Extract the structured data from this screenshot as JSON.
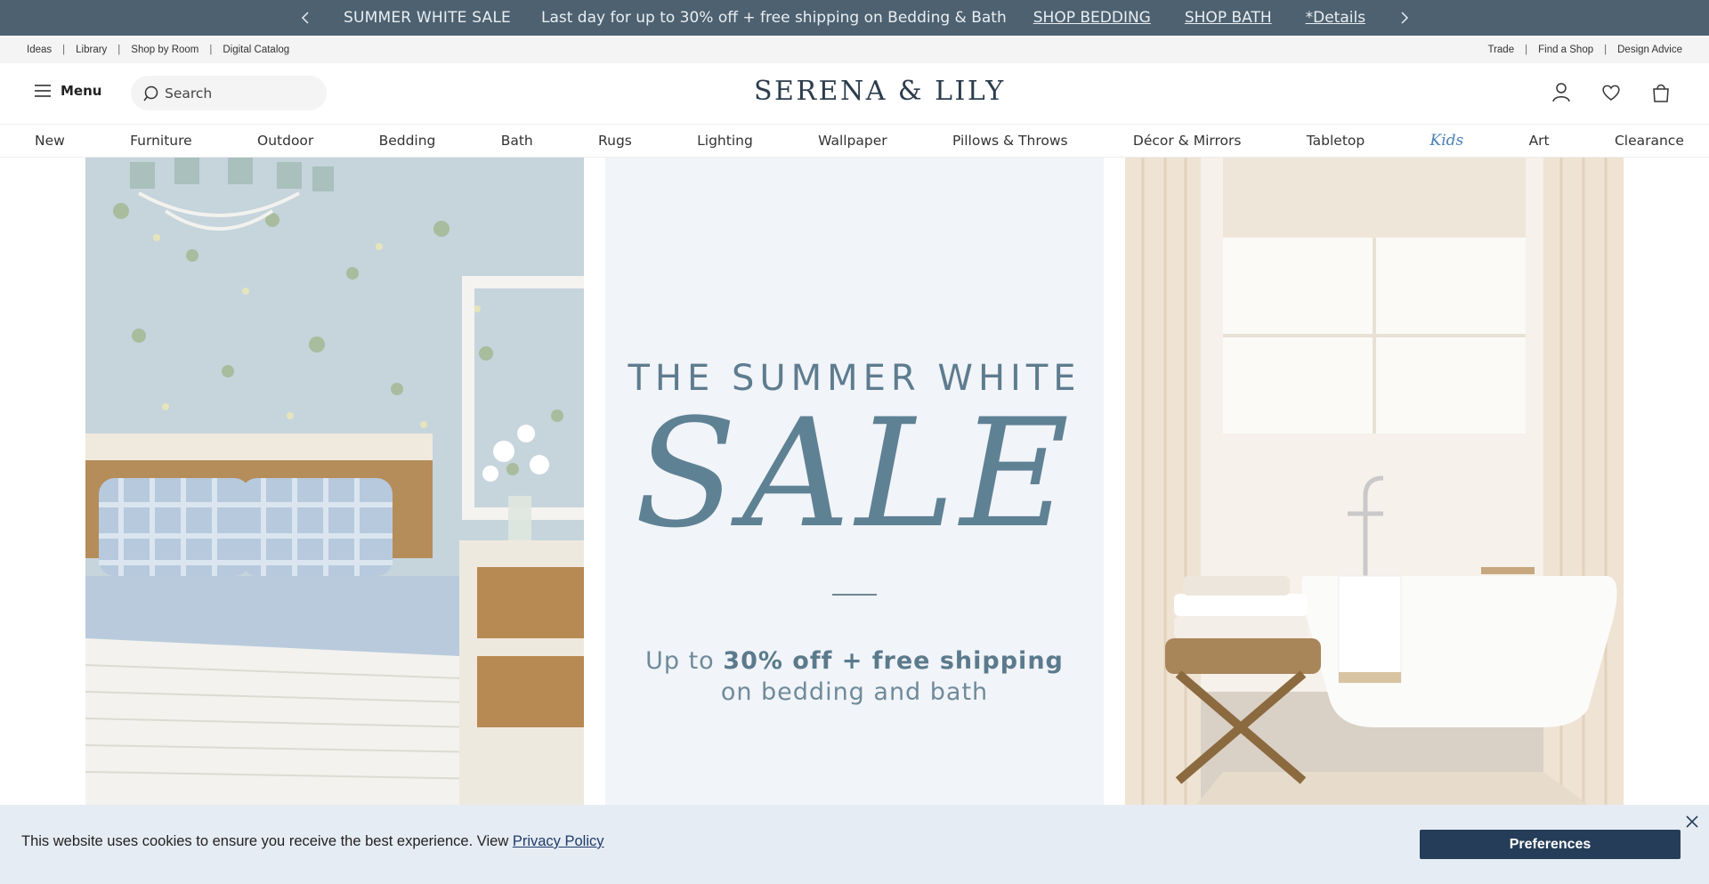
{
  "promo": {
    "title": "SUMMER WHITE SALE",
    "message": "Last day for up to 30% off + free shipping on Bedding & Bath",
    "links": [
      "SHOP BEDDING",
      "SHOP BATH",
      "*Details"
    ]
  },
  "utility": {
    "left": [
      "Ideas",
      "Library",
      "Shop by Room",
      "Digital Catalog"
    ],
    "right": [
      "Trade",
      "Find a Shop",
      "Design Advice"
    ]
  },
  "header": {
    "menu_label": "Menu",
    "search_placeholder": "Search",
    "logo": "SERENA & LILY"
  },
  "nav": {
    "items": [
      "New",
      "Furniture",
      "Outdoor",
      "Bedding",
      "Bath",
      "Rugs",
      "Lighting",
      "Wallpaper",
      "Pillows & Throws",
      "Décor & Mirrors",
      "Tabletop",
      "Kids",
      "Art",
      "Clearance"
    ]
  },
  "hero": {
    "line1": "THE SUMMER WHITE",
    "big": "SALE",
    "sub_prefix": "Up to ",
    "sub_bold": "30% off + free shipping",
    "sub_line2": "on bedding and bath"
  },
  "cookie": {
    "message": "This website uses cookies to ensure you receive the best experience. View ",
    "link": "Privacy Policy",
    "button": "Preferences"
  },
  "colors": {
    "promo_bg": "#4d6170",
    "accent": "#5f8194",
    "button_bg": "#253d58",
    "kids": "#4a7fb5"
  }
}
